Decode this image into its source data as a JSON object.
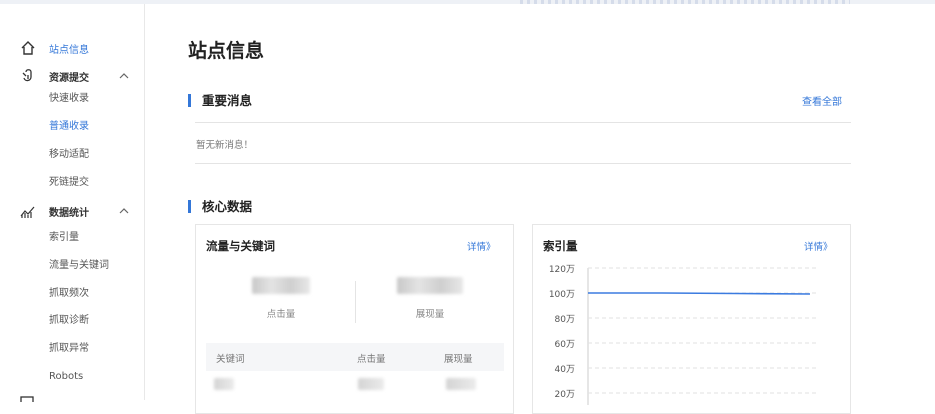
{
  "sidebar": {
    "site_info": "站点信息",
    "resource_submit": {
      "label": "资源提交",
      "items": [
        "快速收录",
        "普通收录",
        "移动适配",
        "死链提交"
      ],
      "active_index": 1
    },
    "data_stats": {
      "label": "数据统计",
      "items": [
        "索引量",
        "流量与关键词",
        "抓取频次",
        "抓取诊断",
        "抓取异常",
        "Robots"
      ]
    }
  },
  "main": {
    "title": "站点信息",
    "important_messages": {
      "title": "重要消息",
      "view_all": "查看全部",
      "empty": "暂无新消息！"
    },
    "core_data": {
      "title": "核心数据",
      "traffic_card": {
        "title": "流量与关键词",
        "details": "详情》",
        "stats": [
          {
            "caption": "点击量"
          },
          {
            "caption": "展现量"
          }
        ],
        "table_headers": [
          "关键词",
          "点击量",
          "展现量"
        ]
      },
      "index_card": {
        "title": "索引量",
        "details": "详情》"
      }
    }
  },
  "colors": {
    "accent": "#3477d8",
    "line": "#3b7be0"
  },
  "chart_data": {
    "type": "line",
    "y_ticks": [
      "120万",
      "100万",
      "80万",
      "60万",
      "40万",
      "20万"
    ],
    "ylim": [
      0,
      120
    ],
    "series": [
      {
        "values": [
          100,
          100,
          99.6,
          99.2
        ]
      }
    ],
    "grid": true
  }
}
